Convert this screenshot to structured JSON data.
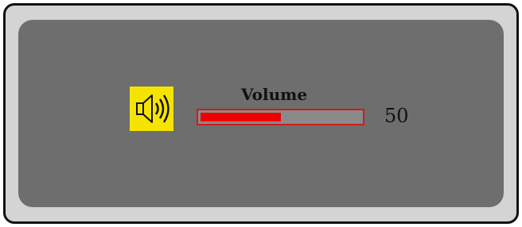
{
  "osd": {
    "icon": "speaker-volume-icon",
    "label": "Volume",
    "value": "50",
    "level_fraction": 0.5,
    "colors": {
      "frame": "#d4d4d4",
      "panel": "#6e6e6e",
      "icon_background": "#f5e400",
      "bar_fill": "#ee0000",
      "bar_border": "#d11a1a"
    }
  }
}
